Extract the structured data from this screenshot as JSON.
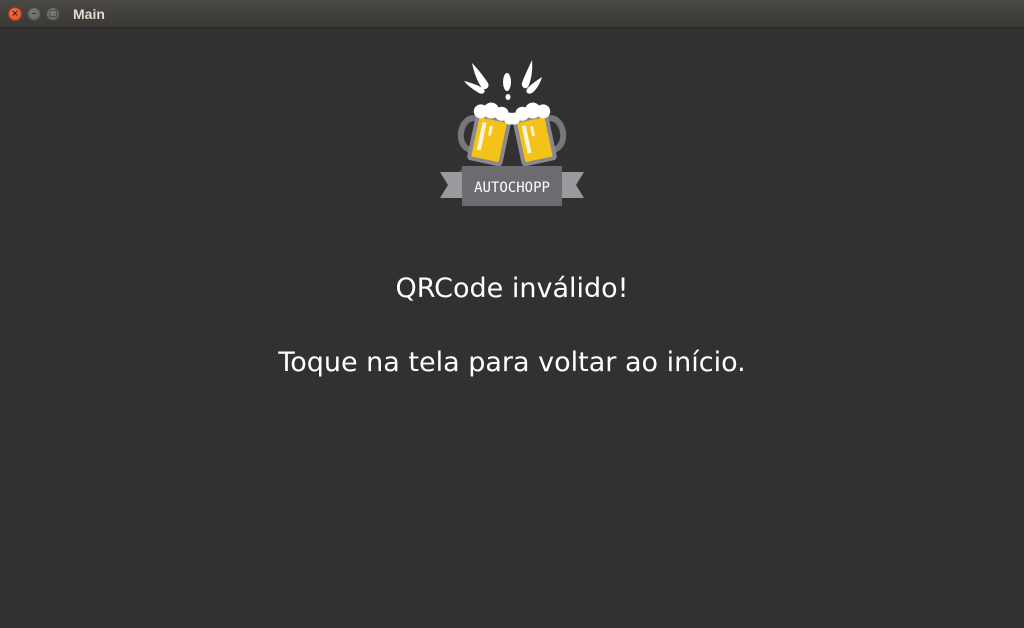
{
  "window": {
    "title": "Main",
    "controls": {
      "close": "×",
      "minimize": "–",
      "maximize": "□"
    }
  },
  "logo": {
    "text": "AUTOCHOPP"
  },
  "main": {
    "error_message": "QRCode inválido!",
    "instruction": "Toque na tela para voltar ao início."
  },
  "colors": {
    "background": "#323031",
    "text": "#ffffff",
    "beer": "#f5c218",
    "banner": "#6c6b70"
  }
}
